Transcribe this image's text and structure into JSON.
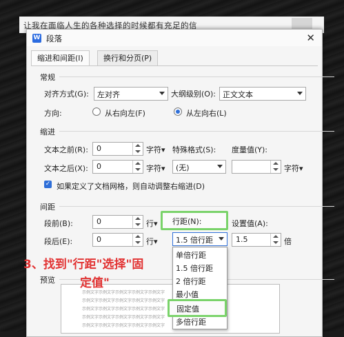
{
  "document": {
    "text": "让我在面临人生的各种选择的时候都有充足的信"
  },
  "dialog": {
    "app_icon": "W",
    "title": "段落",
    "tabs": [
      {
        "label": "缩进和间距(I)"
      },
      {
        "label": "换行和分页(P)"
      }
    ],
    "general": {
      "heading": "常规",
      "alignment_label": "对齐方式(G):",
      "alignment_value": "左对齐",
      "outline_label": "大纲级别(O):",
      "outline_value": "正文文本",
      "direction_label": "方向:",
      "rtl_label": "从右向左(F)",
      "ltr_label": "从左向右(L)"
    },
    "indent": {
      "heading": "缩进",
      "before_label": "文本之前(R):",
      "before_value": "0",
      "after_label": "文本之后(X):",
      "after_value": "0",
      "unit": "字符▾",
      "special_label": "特殊格式(S):",
      "special_value": "(无)",
      "measure_label": "度量值(Y):",
      "grid_check_label": "如果定义了文档网格，则自动调整右缩进(D)"
    },
    "spacing": {
      "heading": "间距",
      "before_label": "段前(B):",
      "before_value": "0",
      "after_label": "段后(E):",
      "after_value": "0",
      "unit": "行▾",
      "line_spacing_label": "行距(N):",
      "line_spacing_value": "1.5 倍行距",
      "set_value_label": "设置值(A):",
      "set_value": "1.5",
      "set_value_unit": "倍"
    },
    "line_spacing_options": [
      "单倍行距",
      "1.5 倍行距",
      "2 倍行距",
      "最小值",
      "固定值",
      "多倍行距"
    ],
    "preview": {
      "heading": "预览",
      "sample": "示例文字示例文字示例文字示例文字示例文字"
    }
  },
  "annotation": {
    "line1": "3、找到\"行距\"选择\"固",
    "line2": "定值\""
  },
  "colors": {
    "highlight": "#7ad36a",
    "annotation": "#e23232",
    "accent": "#2f6fd8"
  }
}
